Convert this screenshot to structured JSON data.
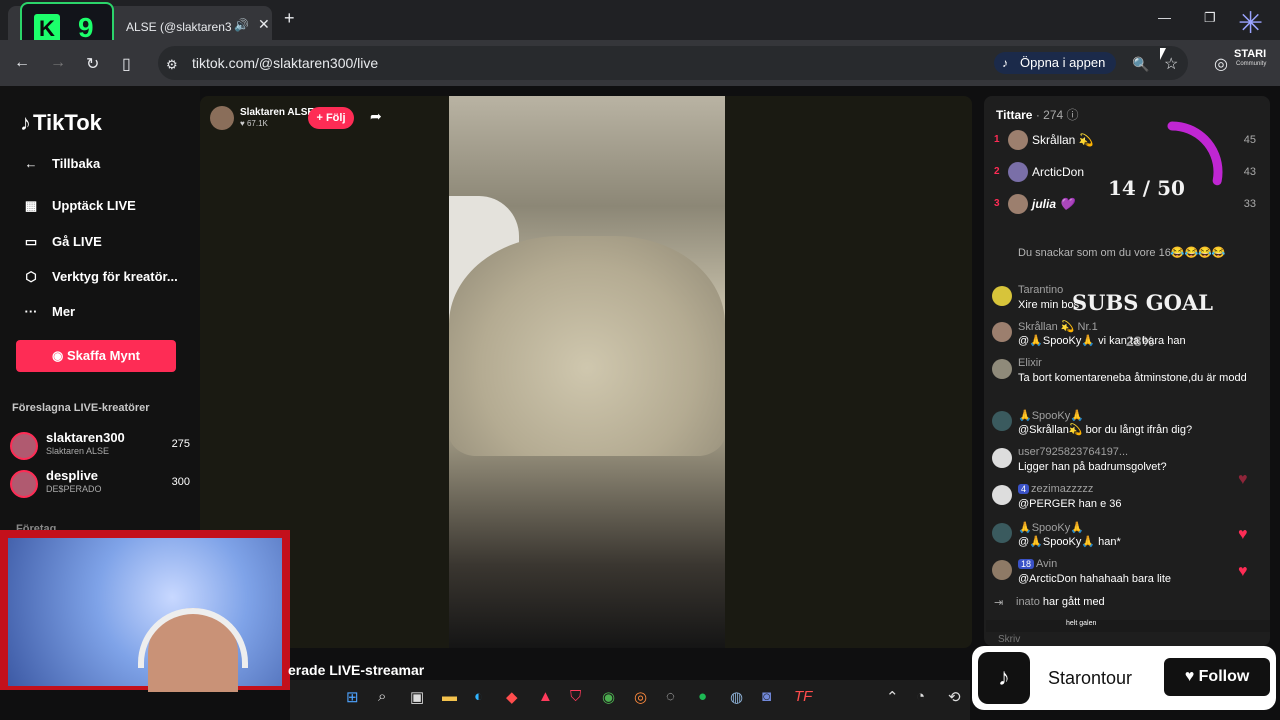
{
  "browser": {
    "tab_title": "ALSE (@slaktaren3",
    "url": "tiktok.com/@slaktaren300/live",
    "open_in_app": "Öppna i appen"
  },
  "overlay": {
    "k9_letter": "K",
    "k9_number": "9",
    "stari_label": "STARI",
    "stari_sub": "Community"
  },
  "sidebar": {
    "logo": "TikTok",
    "back": "Tillbaka",
    "items": [
      {
        "label": "Upptäck LIVE",
        "icon": "calendar-icon"
      },
      {
        "label": "Gå LIVE",
        "icon": "camera-icon"
      },
      {
        "label": "Verktyg för kreatör...",
        "icon": "creator-tools-icon"
      },
      {
        "label": "Mer",
        "icon": "more-icon"
      }
    ],
    "coins_button": "Skaffa Mynt",
    "suggested_title": "Föreslagna LIVE-kreatörer",
    "creators": [
      {
        "name": "slaktaren300",
        "sub": "Slaktaren ALSE",
        "count": "275"
      },
      {
        "name": "desplive",
        "sub": "DE$PERADO",
        "count": "300"
      }
    ],
    "cut_section": "Företag"
  },
  "stream": {
    "host_name": "Slaktaren ALSE",
    "likes": "67.1K",
    "follow": "+ Följ",
    "below_title": "erade LIVE-streamar"
  },
  "chat": {
    "viewers_label": "Tittare",
    "viewers_count": "· 274",
    "ranking": [
      {
        "rank": "1",
        "name": "Skrållan 💫",
        "score": "45"
      },
      {
        "rank": "2",
        "name": "ArcticDon",
        "score": "43"
      },
      {
        "rank": "3",
        "name": "julia 💜",
        "score": "33"
      }
    ],
    "messages": [
      {
        "user": "",
        "text": "Du snackar som om du vore 16😂😂😂😂"
      },
      {
        "user": "Tarantino",
        "text": "Xire min bos"
      },
      {
        "user": "Skrållan 💫 Nr.1",
        "text": "@🙏SpooKy🙏 vi kan ta bara han"
      },
      {
        "user": "Elixir",
        "text": "Ta bort komentareneba åtminstone,du är modd"
      },
      {
        "user": "🙏SpooKy🙏",
        "text": "@Skrållan💫 bor du långt ifrån dig?"
      },
      {
        "user": "user7925823764197...",
        "text": "Ligger han på badrumsgolvet?"
      },
      {
        "user": "zezimazzzzz",
        "badge": "4",
        "text": "@PERGER han e 36"
      },
      {
        "user": "🙏SpooKy🙏",
        "text": "@🙏SpooKy🙏 han*"
      },
      {
        "user": "Avin",
        "badge": "18",
        "text": "@ArcticDon hahahaah bara lite"
      }
    ],
    "joined_user": "inato",
    "joined_text": "har gått med",
    "strip_text": "helt galen",
    "input_placeholder": "Skriv"
  },
  "goal": {
    "current": 14,
    "target": 50,
    "label": "14 / 50",
    "title": "SUBS GOAL",
    "percent": "28%"
  },
  "follow_card": {
    "name": "Starontour",
    "button": "Follow"
  },
  "colors": {
    "accent": "#fe2c55",
    "goal_ring": "#c026d3"
  }
}
